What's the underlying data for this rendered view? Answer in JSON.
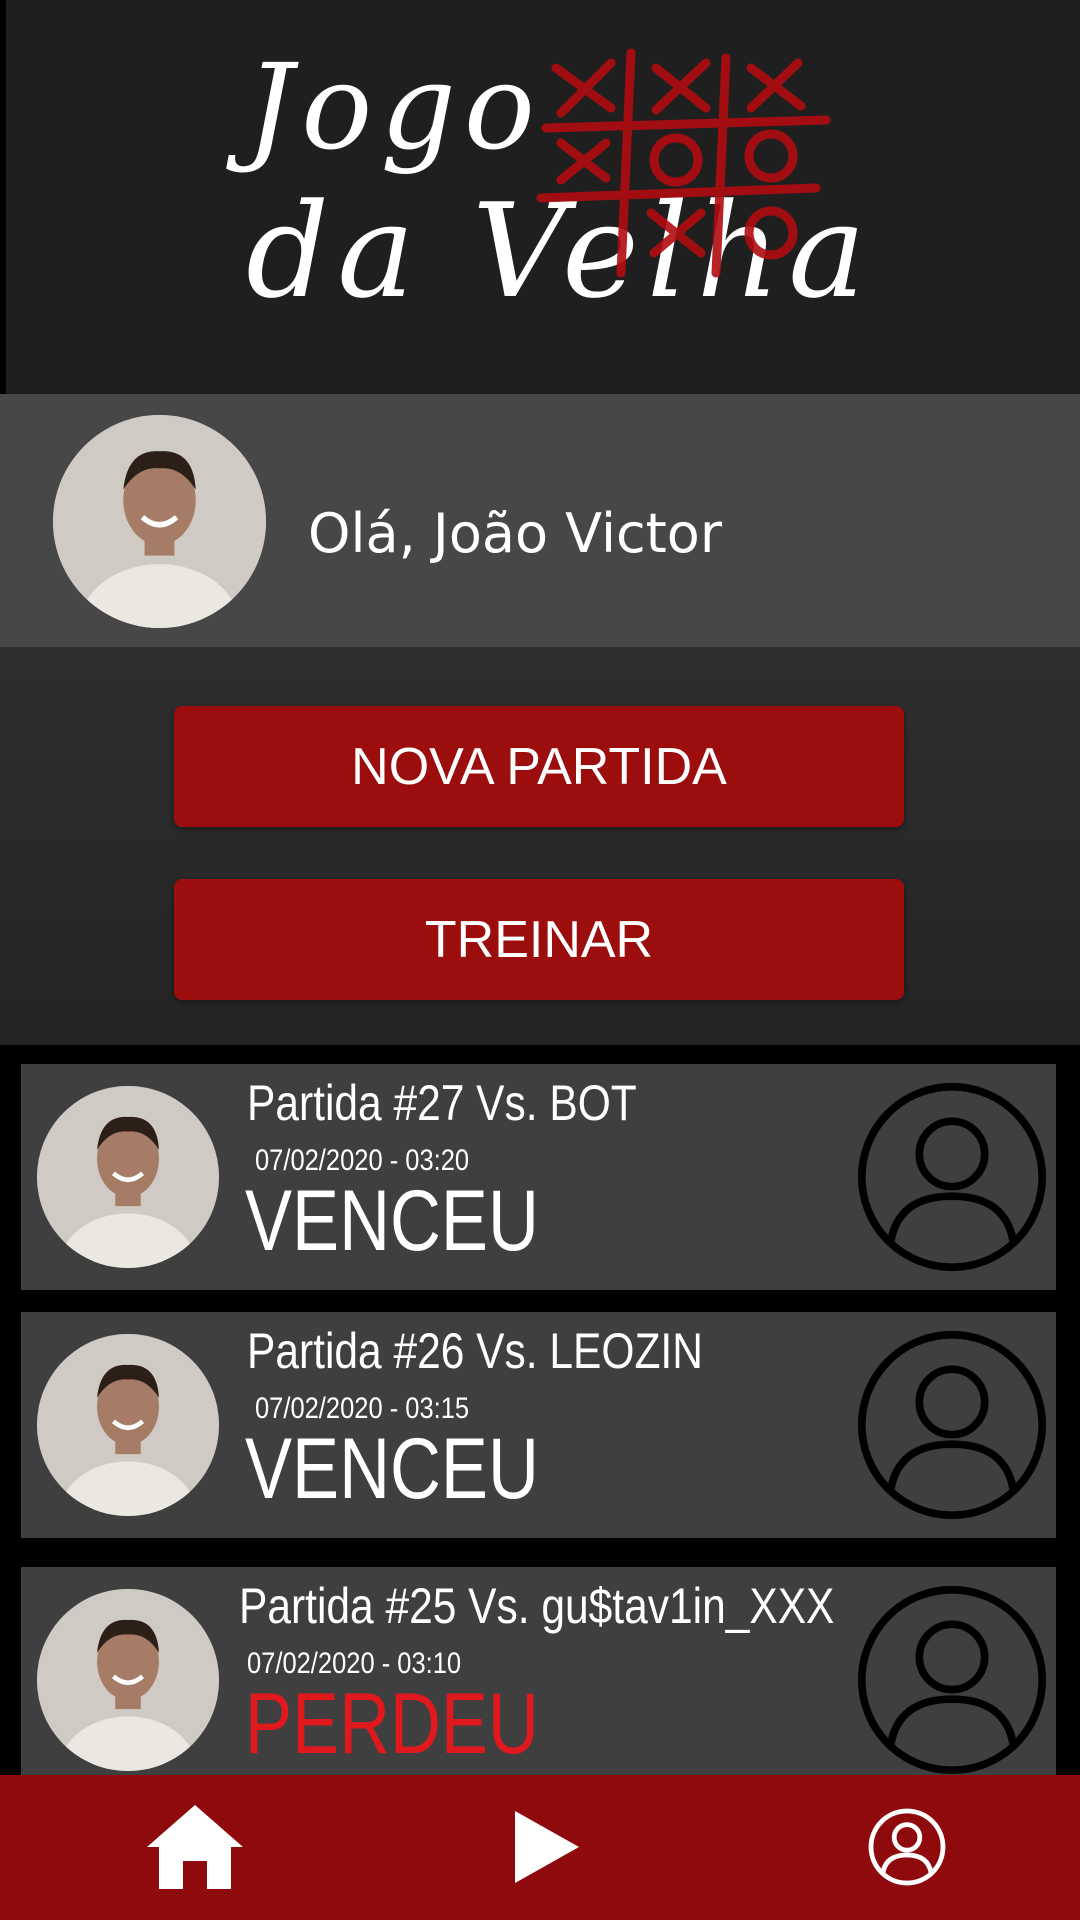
{
  "header": {
    "logo_line1": "Jogo",
    "logo_line2": "da Velha"
  },
  "profile": {
    "greeting": "Olá, João Victor"
  },
  "actions": {
    "new_match_label": "NOVA PARTIDA",
    "train_label": "TREINAR",
    "button_color": "#9c0d0e"
  },
  "matches": [
    {
      "title": "Partida #27 Vs. BOT",
      "datetime": "07/02/2020 - 03:20",
      "result": "VENCEU",
      "status": "won"
    },
    {
      "title": "Partida #26 Vs. LEOZIN",
      "datetime": "07/02/2020 - 03:15",
      "result": "VENCEU",
      "status": "won"
    },
    {
      "title": "Partida #25 Vs. gu$tav1in_XXX",
      "datetime": "07/02/2020 - 03:10",
      "result": "PERDEU",
      "status": "lost"
    }
  ],
  "colors": {
    "accent": "#9c0d0e",
    "lost": "#e0191f",
    "nav_bg": "#8e0a0d"
  },
  "nav": {
    "items": [
      {
        "icon": "home-icon"
      },
      {
        "icon": "play-icon"
      },
      {
        "icon": "user-icon"
      }
    ]
  }
}
